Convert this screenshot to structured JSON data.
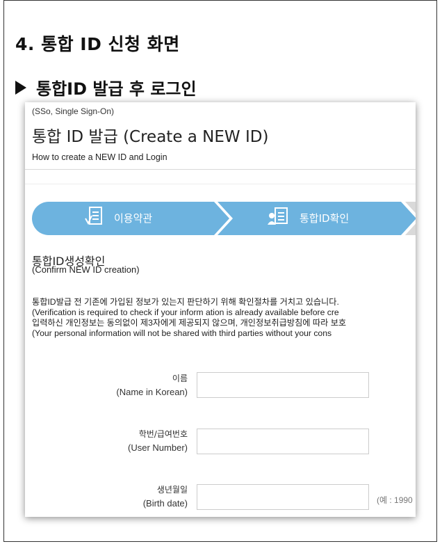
{
  "doc": {
    "section_heading": "4. 통합 ID 신청 화면",
    "subheading": "통합ID 발급 후 로그인"
  },
  "screen": {
    "sso_label": "(SSo, Single Sign-On)",
    "title": "통합 ID 발급 (Create a NEW ID)",
    "howto": "How to create a NEW ID and Login",
    "steps": [
      {
        "label": "이용약관",
        "icon": "document-check-icon"
      },
      {
        "label": "통합ID확인",
        "icon": "id-card-icon"
      }
    ],
    "step_color": "#6db3df",
    "confirm_title": "통합ID생성확인",
    "confirm_subtitle": "(Confirm NEW ID creation)",
    "notice_lines": [
      "통합ID발급 전 기존에 가입된 정보가 있는지 판단하기 위해 확인절차를 거치고 있습니다.",
      "(Verification is required to check if your inform ation is already available before cre",
      "입력하신 개인정보는 동의없이 제3자에게 제공되지 않으며, 개인정보취급방침에 따라 보호",
      "(Your personal information will not be shared with third parties without your cons"
    ],
    "fields": [
      {
        "label_ko": "이름",
        "label_en": "(Name in Korean)",
        "value": ""
      },
      {
        "label_ko": "학번/급여번호",
        "label_en": "(User Number)",
        "value": ""
      },
      {
        "label_ko": "생년월일",
        "label_en": "(Birth date)",
        "value": "",
        "hint": "(예 : 1990"
      }
    ]
  }
}
